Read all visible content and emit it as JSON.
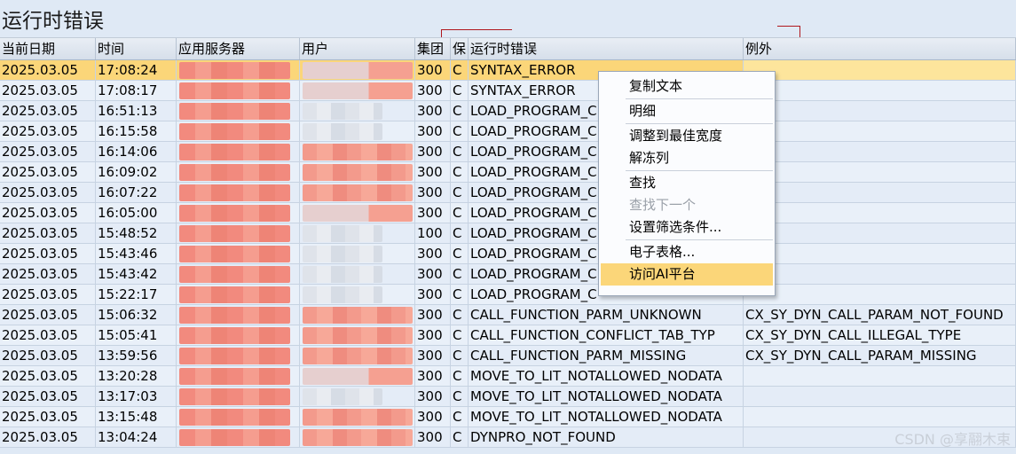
{
  "window": {
    "title": "运行时错误"
  },
  "columns": [
    "当前日期",
    "时间",
    "应用服务器",
    "用户",
    "集团",
    "保",
    "运行时错误",
    "例外"
  ],
  "rows": [
    {
      "date": "2025.03.05",
      "time": "17:08:24",
      "client": "300",
      "flag": "C",
      "error": "SYNTAX_ERROR",
      "exception": "",
      "user_style": "mix",
      "selected": true
    },
    {
      "date": "2025.03.05",
      "time": "17:08:17",
      "client": "300",
      "flag": "C",
      "error": "SYNTAX_ERROR",
      "exception": "",
      "user_style": "mix",
      "selected": false
    },
    {
      "date": "2025.03.05",
      "time": "16:51:13",
      "client": "300",
      "flag": "C",
      "error": "LOAD_PROGRAM_C",
      "exception": "",
      "user_style": "grey",
      "selected": false
    },
    {
      "date": "2025.03.05",
      "time": "16:15:58",
      "client": "300",
      "flag": "C",
      "error": "LOAD_PROGRAM_C",
      "exception": "",
      "user_style": "grey",
      "selected": false
    },
    {
      "date": "2025.03.05",
      "time": "16:14:06",
      "client": "300",
      "flag": "C",
      "error": "LOAD_PROGRAM_C",
      "exception": "",
      "user_style": "red",
      "selected": false
    },
    {
      "date": "2025.03.05",
      "time": "16:09:02",
      "client": "300",
      "flag": "C",
      "error": "LOAD_PROGRAM_C",
      "exception": "",
      "user_style": "red",
      "selected": false
    },
    {
      "date": "2025.03.05",
      "time": "16:07:22",
      "client": "300",
      "flag": "C",
      "error": "LOAD_PROGRAM_C",
      "exception": "",
      "user_style": "red",
      "selected": false
    },
    {
      "date": "2025.03.05",
      "time": "16:05:00",
      "client": "300",
      "flag": "C",
      "error": "LOAD_PROGRAM_C",
      "exception": "",
      "user_style": "mix",
      "selected": false
    },
    {
      "date": "2025.03.05",
      "time": "15:48:52",
      "client": "100",
      "flag": "C",
      "error": "LOAD_PROGRAM_C",
      "exception": "",
      "user_style": "grey",
      "selected": false
    },
    {
      "date": "2025.03.05",
      "time": "15:43:46",
      "client": "300",
      "flag": "C",
      "error": "LOAD_PROGRAM_C",
      "exception": "",
      "user_style": "grey",
      "selected": false
    },
    {
      "date": "2025.03.05",
      "time": "15:43:42",
      "client": "300",
      "flag": "C",
      "error": "LOAD_PROGRAM_C",
      "exception": "",
      "user_style": "grey",
      "selected": false
    },
    {
      "date": "2025.03.05",
      "time": "15:22:17",
      "client": "300",
      "flag": "C",
      "error": "LOAD_PROGRAM_C",
      "exception": "",
      "user_style": "grey",
      "selected": false
    },
    {
      "date": "2025.03.05",
      "time": "15:06:32",
      "client": "300",
      "flag": "C",
      "error": "CALL_FUNCTION_PARM_UNKNOWN",
      "exception": "CX_SY_DYN_CALL_PARAM_NOT_FOUND",
      "user_style": "red",
      "selected": false
    },
    {
      "date": "2025.03.05",
      "time": "15:05:41",
      "client": "300",
      "flag": "C",
      "error": "CALL_FUNCTION_CONFLICT_TAB_TYP",
      "exception": "CX_SY_DYN_CALL_ILLEGAL_TYPE",
      "user_style": "red",
      "selected": false
    },
    {
      "date": "2025.03.05",
      "time": "13:59:56",
      "client": "300",
      "flag": "C",
      "error": "CALL_FUNCTION_PARM_MISSING",
      "exception": "CX_SY_DYN_CALL_PARAM_MISSING",
      "user_style": "red",
      "selected": false
    },
    {
      "date": "2025.03.05",
      "time": "13:20:28",
      "client": "300",
      "flag": "C",
      "error": "MOVE_TO_LIT_NOTALLOWED_NODATA",
      "exception": "",
      "user_style": "mix",
      "selected": false
    },
    {
      "date": "2025.03.05",
      "time": "13:17:03",
      "client": "300",
      "flag": "C",
      "error": "MOVE_TO_LIT_NOTALLOWED_NODATA",
      "exception": "",
      "user_style": "grey",
      "selected": false
    },
    {
      "date": "2025.03.05",
      "time": "13:15:48",
      "client": "300",
      "flag": "C",
      "error": "MOVE_TO_LIT_NOTALLOWED_NODATA",
      "exception": "",
      "user_style": "red",
      "selected": false
    },
    {
      "date": "2025.03.05",
      "time": "13:04:24",
      "client": "300",
      "flag": "C",
      "error": "DYNPRO_NOT_FOUND",
      "exception": "",
      "user_style": "red",
      "selected": false
    }
  ],
  "context_menu": {
    "items": [
      {
        "label": "复制文本",
        "disabled": false,
        "highlighted": false,
        "sep_before": false
      },
      {
        "label": "明细",
        "disabled": false,
        "highlighted": false,
        "sep_before": true
      },
      {
        "label": "调整到最佳宽度",
        "disabled": false,
        "highlighted": false,
        "sep_before": true
      },
      {
        "label": "解冻列",
        "disabled": false,
        "highlighted": false,
        "sep_before": false
      },
      {
        "label": "查找",
        "disabled": false,
        "highlighted": false,
        "sep_before": true
      },
      {
        "label": "查找下一个",
        "disabled": true,
        "highlighted": false,
        "sep_before": false
      },
      {
        "label": "设置筛选条件...",
        "disabled": false,
        "highlighted": false,
        "sep_before": false
      },
      {
        "label": "电子表格...",
        "disabled": false,
        "highlighted": false,
        "sep_before": true
      },
      {
        "label": "访问AI平台",
        "disabled": false,
        "highlighted": true,
        "sep_before": false
      }
    ]
  },
  "watermark": "CSDN @享翮木束",
  "colors": {
    "selected": "#fbd679",
    "annotation": "#b0181e",
    "redaction": "#f28a7e"
  }
}
